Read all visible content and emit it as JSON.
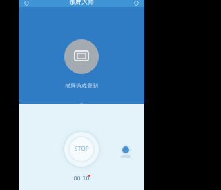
{
  "app": {
    "title": "录屏大师"
  },
  "header": {
    "left_icon": "back-icon",
    "right_icon": "settings-icon"
  },
  "mode": {
    "label": "横屏游戏录制",
    "icon": "landscape-phone-icon"
  },
  "controls": {
    "stop_label": "STOP",
    "timer": "00:10"
  },
  "colors": {
    "title_bar": "#3f94d6",
    "top_panel": "#2f7cc4",
    "bottom_panel": "#e4f3f9",
    "recording_dot": "#e04d4d"
  }
}
